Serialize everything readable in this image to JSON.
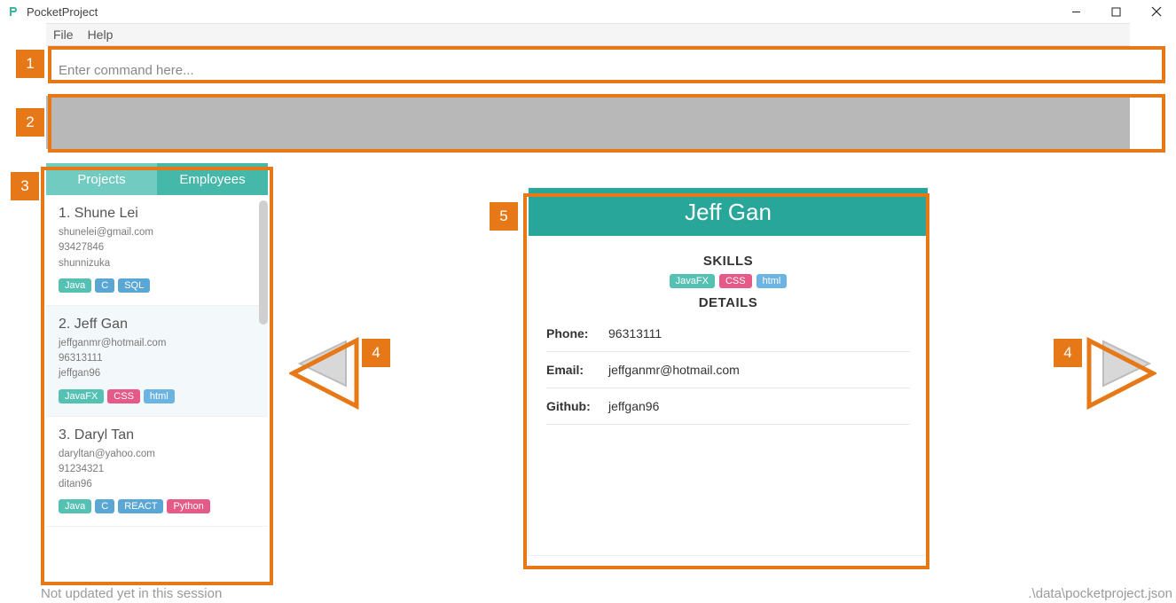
{
  "window": {
    "title": "PocketProject"
  },
  "menu": {
    "file": "File",
    "help": "Help"
  },
  "command": {
    "placeholder": "Enter command here..."
  },
  "tabs": {
    "projects": "Projects",
    "employees": "Employees"
  },
  "employees": [
    {
      "index": "1.",
      "name": "Shune Lei",
      "email": "shunelei@gmail.com",
      "phone": "93427846",
      "github": "shunnizuka",
      "tags": [
        {
          "text": "Java",
          "cls": "tag-teal"
        },
        {
          "text": "C",
          "cls": "tag-blue"
        },
        {
          "text": "SQL",
          "cls": "tag-blue"
        }
      ],
      "selected": false
    },
    {
      "index": "2.",
      "name": "Jeff Gan",
      "email": "jeffganmr@hotmail.com",
      "phone": "96313111",
      "github": "jeffgan96",
      "tags": [
        {
          "text": "JavaFX",
          "cls": "tag-teal"
        },
        {
          "text": "CSS",
          "cls": "tag-pink"
        },
        {
          "text": "html",
          "cls": "tag-lblue"
        }
      ],
      "selected": true
    },
    {
      "index": "3.",
      "name": "Daryl Tan",
      "email": "daryltan@yahoo.com",
      "phone": "91234321",
      "github": "ditan96",
      "tags": [
        {
          "text": "Java",
          "cls": "tag-teal"
        },
        {
          "text": "C",
          "cls": "tag-blue"
        },
        {
          "text": "REACT",
          "cls": "tag-blue"
        },
        {
          "text": "Python",
          "cls": "tag-pink"
        }
      ],
      "selected": false
    }
  ],
  "detail": {
    "name": "Jeff Gan",
    "skills_label": "SKILLS",
    "details_label": "DETAILS",
    "skills": [
      {
        "text": "JavaFX",
        "cls": "tag-teal"
      },
      {
        "text": "CSS",
        "cls": "tag-pink"
      },
      {
        "text": "html",
        "cls": "tag-lblue"
      }
    ],
    "phone_label": "Phone:",
    "phone": "96313111",
    "email_label": "Email:",
    "email": "jeffganmr@hotmail.com",
    "github_label": "Github:",
    "github": "jeffgan96"
  },
  "status": {
    "left": "Not updated yet in this session",
    "right": ".\\data\\pocketproject.json"
  },
  "annotations": {
    "n1": "1",
    "n2": "2",
    "n3": "3",
    "n4a": "4",
    "n4b": "4",
    "n5": "5"
  }
}
